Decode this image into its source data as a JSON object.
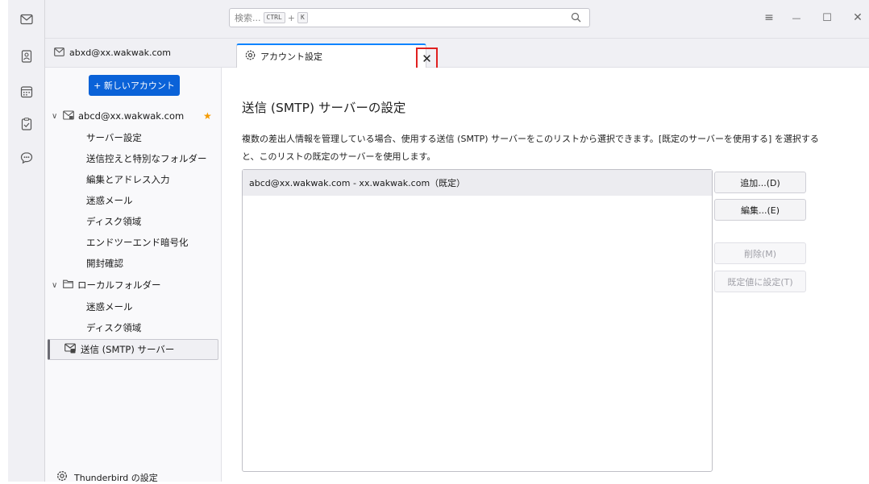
{
  "search": {
    "placeholder": "検索...",
    "shortcut_ctrl": "CTRL",
    "shortcut_plus": "+",
    "shortcut_key": "K"
  },
  "window_controls": {
    "menu": "≡",
    "minimize": "—",
    "maximize": "☐",
    "close": "✕"
  },
  "account_header": {
    "email": "abxd@xx.wakwak.com"
  },
  "tab": {
    "label": "アカウント設定",
    "close": "✕"
  },
  "sidebar": {
    "new_account_label": "+ 新しいアカウント",
    "account": {
      "chevron": "∨",
      "email": "abcd@xx.wakwak.com",
      "star": "★"
    },
    "account_items": [
      {
        "label": "サーバー設定"
      },
      {
        "label": "送信控えと特別なフォルダー"
      },
      {
        "label": "編集とアドレス入力"
      },
      {
        "label": "迷惑メール"
      },
      {
        "label": "ディスク領域"
      },
      {
        "label": "エンドツーエンド暗号化"
      },
      {
        "label": "開封確認"
      }
    ],
    "local": {
      "chevron": "∨",
      "label": "ローカルフォルダー"
    },
    "local_items": [
      {
        "label": "迷惑メール"
      },
      {
        "label": "ディスク領域"
      }
    ],
    "smtp": {
      "label": "送信 (SMTP) サーバー"
    },
    "settings_label": "Thunderbird の設定"
  },
  "main": {
    "heading": "送信 (SMTP) サーバーの設定",
    "description": "複数の差出人情報を管理している場合、使用する送信 (SMTP) サーバーをこのリストから選択できます。[既定のサーバーを使用する] を選択すると、このリストの既定のサーバーを使用します。",
    "servers": [
      {
        "label": "abcd@xx.wakwak.com - xx.wakwak.com（既定）"
      }
    ],
    "buttons": {
      "add": "追加...(D)",
      "edit": "編集...(E)",
      "delete": "削除(M)",
      "set_default": "既定値に設定(T)"
    }
  },
  "colors": {
    "accent": "#0a62d8",
    "highlight_border": "#e02020",
    "star": "#f59b00"
  }
}
